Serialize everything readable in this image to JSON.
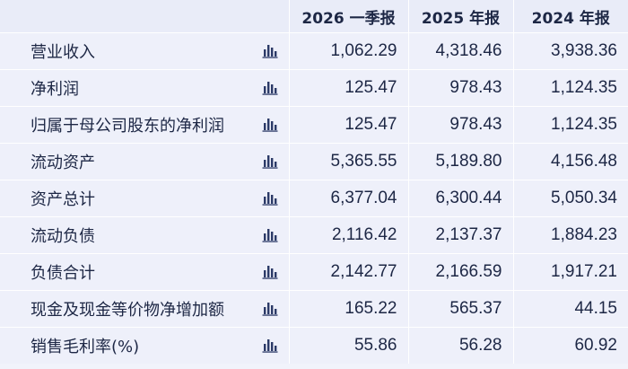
{
  "table": {
    "headers": [
      "2026 一季报",
      "2025 年报",
      "2024 年报"
    ],
    "rows": [
      {
        "label": "营业收入",
        "values": [
          "1,062.29",
          "4,318.46",
          "3,938.36"
        ]
      },
      {
        "label": "净利润",
        "values": [
          "125.47",
          "978.43",
          "1,124.35"
        ]
      },
      {
        "label": "归属于母公司股东的净利润",
        "values": [
          "125.47",
          "978.43",
          "1,124.35"
        ]
      },
      {
        "label": "流动资产",
        "values": [
          "5,365.55",
          "5,189.80",
          "4,156.48"
        ]
      },
      {
        "label": "资产总计",
        "values": [
          "6,377.04",
          "6,300.44",
          "5,050.34"
        ]
      },
      {
        "label": "流动负债",
        "values": [
          "2,116.42",
          "2,137.37",
          "1,884.23"
        ]
      },
      {
        "label": "负债合计",
        "values": [
          "2,142.77",
          "2,166.59",
          "1,917.21"
        ]
      },
      {
        "label": "现金及现金等价物净增加额",
        "values": [
          "165.22",
          "565.37",
          "44.15"
        ]
      },
      {
        "label": "销售毛利率(%)",
        "values": [
          "55.86",
          "56.28",
          "60.92"
        ]
      }
    ]
  },
  "icons": {
    "row_chart": "bar-chart-icon"
  },
  "colors": {
    "background": "#eef0fa",
    "header_background": "#e9ecf8",
    "text": "#1d2745",
    "icon": "#2b3a67"
  }
}
